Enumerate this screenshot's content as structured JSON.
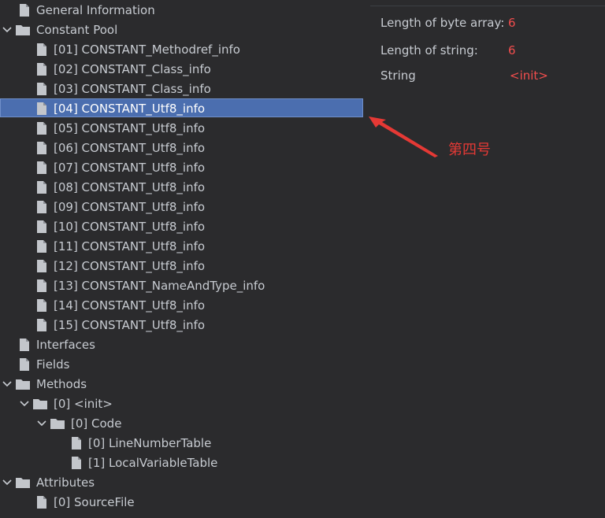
{
  "tree": {
    "items": [
      {
        "label": "General Information",
        "type": "file",
        "depth": 0,
        "chevron": "none"
      },
      {
        "label": "Constant Pool",
        "type": "folder",
        "depth": 0,
        "chevron": "down"
      },
      {
        "label": "[01] CONSTANT_Methodref_info",
        "type": "file",
        "depth": 1,
        "chevron": "none"
      },
      {
        "label": "[02] CONSTANT_Class_info",
        "type": "file",
        "depth": 1,
        "chevron": "none"
      },
      {
        "label": "[03] CONSTANT_Class_info",
        "type": "file",
        "depth": 1,
        "chevron": "none"
      },
      {
        "label": "[04] CONSTANT_Utf8_info",
        "type": "file",
        "depth": 1,
        "chevron": "none",
        "selected": true
      },
      {
        "label": "[05] CONSTANT_Utf8_info",
        "type": "file",
        "depth": 1,
        "chevron": "none"
      },
      {
        "label": "[06] CONSTANT_Utf8_info",
        "type": "file",
        "depth": 1,
        "chevron": "none"
      },
      {
        "label": "[07] CONSTANT_Utf8_info",
        "type": "file",
        "depth": 1,
        "chevron": "none"
      },
      {
        "label": "[08] CONSTANT_Utf8_info",
        "type": "file",
        "depth": 1,
        "chevron": "none"
      },
      {
        "label": "[09] CONSTANT_Utf8_info",
        "type": "file",
        "depth": 1,
        "chevron": "none"
      },
      {
        "label": "[10] CONSTANT_Utf8_info",
        "type": "file",
        "depth": 1,
        "chevron": "none"
      },
      {
        "label": "[11] CONSTANT_Utf8_info",
        "type": "file",
        "depth": 1,
        "chevron": "none"
      },
      {
        "label": "[12] CONSTANT_Utf8_info",
        "type": "file",
        "depth": 1,
        "chevron": "none"
      },
      {
        "label": "[13] CONSTANT_NameAndType_info",
        "type": "file",
        "depth": 1,
        "chevron": "none"
      },
      {
        "label": "[14] CONSTANT_Utf8_info",
        "type": "file",
        "depth": 1,
        "chevron": "none"
      },
      {
        "label": "[15] CONSTANT_Utf8_info",
        "type": "file",
        "depth": 1,
        "chevron": "none"
      },
      {
        "label": "Interfaces",
        "type": "file",
        "depth": 0,
        "chevron": "none"
      },
      {
        "label": "Fields",
        "type": "file",
        "depth": 0,
        "chevron": "none"
      },
      {
        "label": "Methods",
        "type": "folder",
        "depth": 0,
        "chevron": "down"
      },
      {
        "label": "[0] <init>",
        "type": "folder",
        "depth": 1,
        "chevron": "down"
      },
      {
        "label": "[0] Code",
        "type": "folder",
        "depth": 2,
        "chevron": "down"
      },
      {
        "label": "[0] LineNumberTable",
        "type": "file",
        "depth": 3,
        "chevron": "none"
      },
      {
        "label": "[1] LocalVariableTable",
        "type": "file",
        "depth": 3,
        "chevron": "none"
      },
      {
        "label": "Attributes",
        "type": "folder",
        "depth": 0,
        "chevron": "down"
      },
      {
        "label": "[0] SourceFile",
        "type": "file",
        "depth": 1,
        "chevron": "none"
      }
    ]
  },
  "details": {
    "rows": [
      {
        "label": "Length of byte array:",
        "value": "6"
      },
      {
        "label": "Length of string:",
        "value": "6"
      },
      {
        "label": "String",
        "value": "<init>"
      }
    ]
  },
  "annotation": {
    "text": "第四号"
  },
  "colors": {
    "background": "#2b2b2d",
    "selection": "#4b6eaf",
    "value_red": "#f14d4d",
    "annotation_red": "#e53935"
  }
}
